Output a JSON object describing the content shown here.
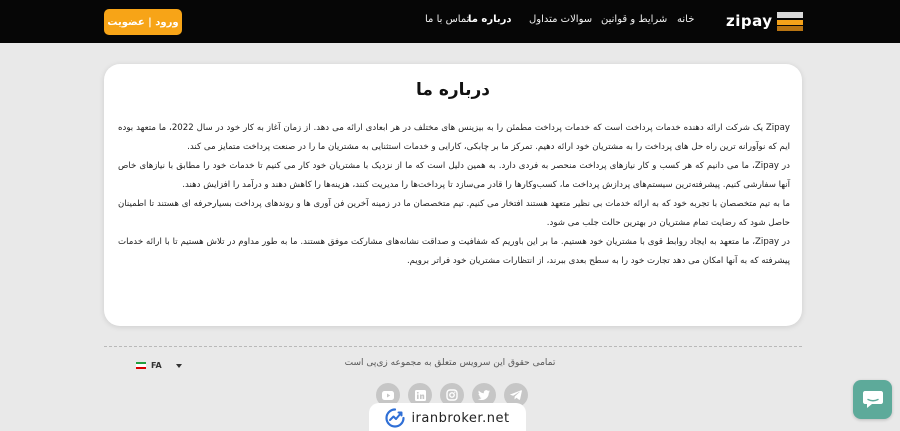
{
  "header": {
    "logo_text": "zipay",
    "nav": [
      {
        "label": "خانه"
      },
      {
        "label": "شرایط و قوانین"
      },
      {
        "label": "سوالات متداول"
      },
      {
        "label": "درباره ما",
        "active": true
      },
      {
        "label": "تماس با ما"
      }
    ],
    "login_label": "ورود | عضویت"
  },
  "about": {
    "title": "درباره ما",
    "paragraphs": [
      "Zipay یک شرکت ارائه دهنده خدمات پرداخت است که خدمات پرداخت مطمئن را به بیزینس های مختلف در هر ابعادی ارائه می دهد. از زمان آغاز به کار خود در سال 2022، ما متعهد بوده ایم که نوآورانه ترین راه حل های پرداخت را به مشتریان خود ارائه دهیم. تمرکز ما بر چابکی، کارایی و خدمات استثنایی به مشتریان ما را در صنعت پرداخت متمایز می کند.",
      "در Zipay، ما می دانیم که هر کسب و کار نیازهای پرداخت منحصر به فردی دارد. به همین دلیل است که ما از نزدیک با مشتریان خود کار می کنیم تا خدمات خود را مطابق با نیازهای خاص آنها سفارشی کنیم. پیشرفته‌ترین سیستم‌های پردازش پرداخت ما، کسب‌وکارها را قادر می‌سازد تا پرداخت‌ها را مدیریت کنند، هزینه‌ها را کاهش دهند و درآمد را افزایش دهند.",
      "ما به تیم متخصصان با تجربه خود که به ارائه خدمات بی نظیر متعهد هستند افتخار می کنیم. تیم متخصصان ما در زمینه آخرین فن آوری ها و روندهای پرداخت بسیارحرفه ای هستند تا اطمینان حاصل شود که رضایت تمام مشتریان در بهترین حالت جلب می شود.",
      "در Zipay، ما متعهد به ایجاد روابط قوی با مشتریان خود هستیم. ما بر این باوریم که شفافیت و صداقت نشانه‌های مشارکت موفق هستند. ما به طور مداوم در تلاش هستیم تا با ارائه خدمات پیشرفته که به آنها امکان می دهد تجارت خود را به سطح بعدی ببرند، از انتظارات مشتریان خود فراتر برویم."
    ]
  },
  "footer": {
    "copyright": "تمامی حقوق این سرویس متعلق به مجموعه زی‌پی است",
    "language": "FA",
    "social_icons": [
      "youtube-icon",
      "linkedin-icon",
      "instagram-icon",
      "twitter-icon",
      "telegram-icon"
    ]
  },
  "watermark": {
    "text": "iranbroker.net"
  },
  "colors": {
    "header_bg": "#060606",
    "accent": "#f7a417",
    "page_bg": "#e9e9e9",
    "chat_button": "#5daa9a"
  }
}
